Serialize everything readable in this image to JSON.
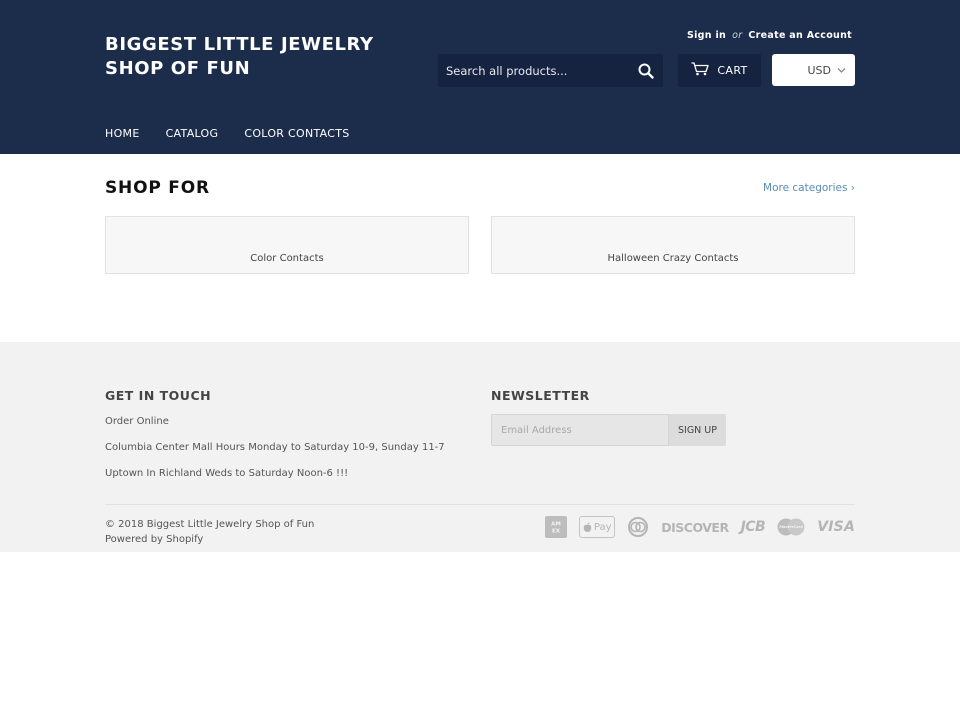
{
  "header": {
    "site_title": "BIGGEST LITTLE JEWELRY SHOP OF FUN",
    "sign_in": "Sign in",
    "or": "or",
    "create_account": "Create an Account",
    "search_placeholder": "Search all products...",
    "cart_label": "CART",
    "currency": "USD",
    "colors": {
      "background": "#1c2d4b",
      "control": "#152340"
    }
  },
  "nav": {
    "items": [
      {
        "label": "HOME"
      },
      {
        "label": "CATALOG"
      },
      {
        "label": "COLOR CONTACTS"
      }
    ]
  },
  "main": {
    "section_title": "SHOP FOR",
    "more_link": "More categories ›",
    "collections": [
      {
        "label": "Color Contacts"
      },
      {
        "label": "Halloween Crazy Contacts"
      }
    ]
  },
  "footer": {
    "get_in_touch": {
      "heading": "GET IN TOUCH",
      "lines": [
        "Order Online",
        "Columbia Center Mall Hours Monday to Saturday 10-9, Sunday 11-7",
        "Uptown In Richland Weds to Saturday Noon-6 !!!"
      ]
    },
    "newsletter": {
      "heading": "NEWSLETTER",
      "email_placeholder": "Email Address",
      "button": "SIGN UP"
    },
    "copyright": "© 2018 Biggest Little Jewelry Shop of Fun",
    "powered_by": "Powered by Shopify",
    "payment_icons": [
      "american-express-icon",
      "apple-pay-icon",
      "diners-club-icon",
      "discover-icon",
      "jcb-icon",
      "master-icon",
      "visa-icon"
    ],
    "payment_texts": {
      "apple_pay": "Pay",
      "discover": "DISCOVER",
      "jcb": "JCB",
      "master": "MasterCard",
      "visa": "VISA"
    }
  }
}
